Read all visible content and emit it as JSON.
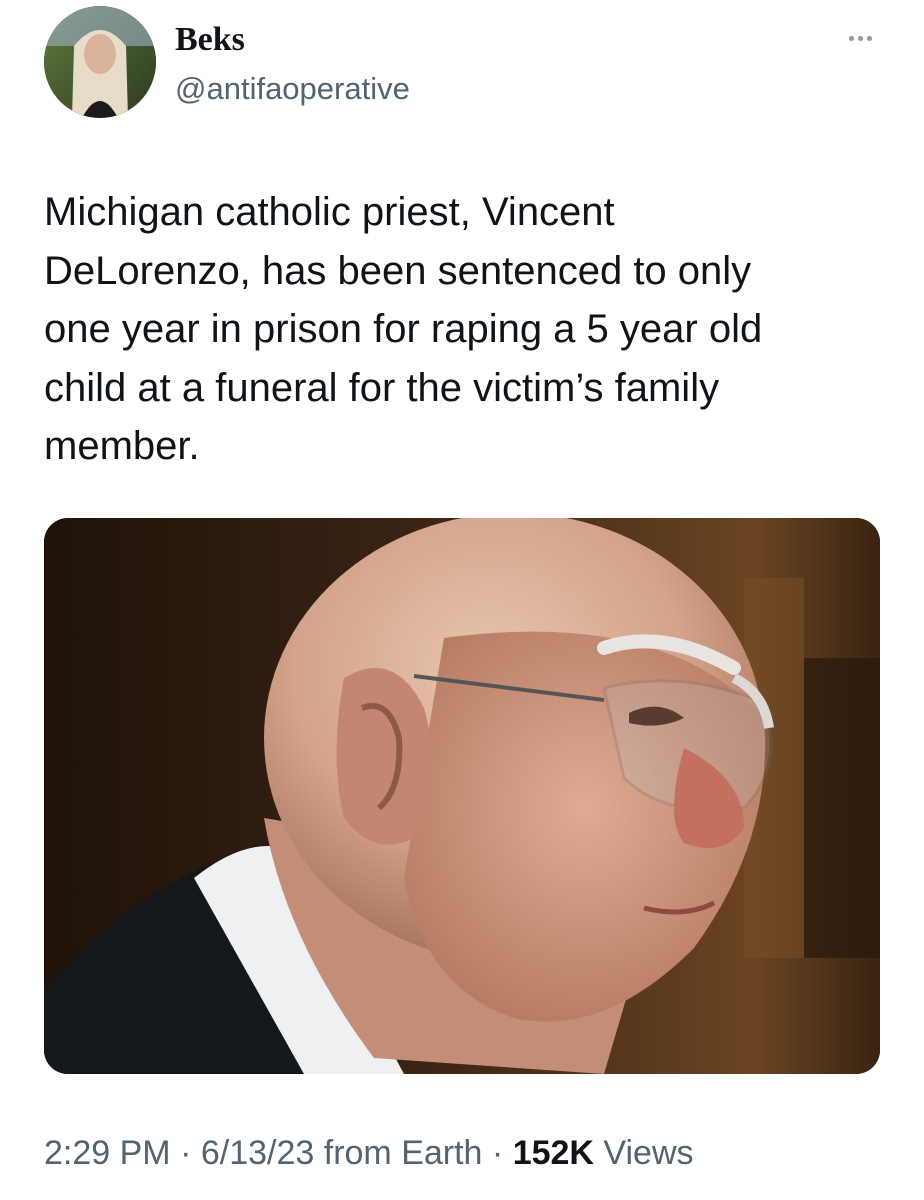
{
  "author": {
    "display_name": "Beks",
    "handle": "@antifaoperative"
  },
  "tweet": {
    "text": "Michigan catholic priest, Vincent\nDeLorenzo, has been sentenced to only\none year in prison for raping a 5 year old\nchild at a funeral for the victim’s family\nmember."
  },
  "meta": {
    "time": "2:29 PM",
    "sep1": " · ",
    "date": "6/13/23",
    "source": " from Earth",
    "sep2": " · ",
    "views_count": "152K",
    "views_label": " Views"
  },
  "icons": {
    "more": "more-horizontal-icon"
  },
  "colors": {
    "text": "#0f1419",
    "secondary": "#536471"
  }
}
